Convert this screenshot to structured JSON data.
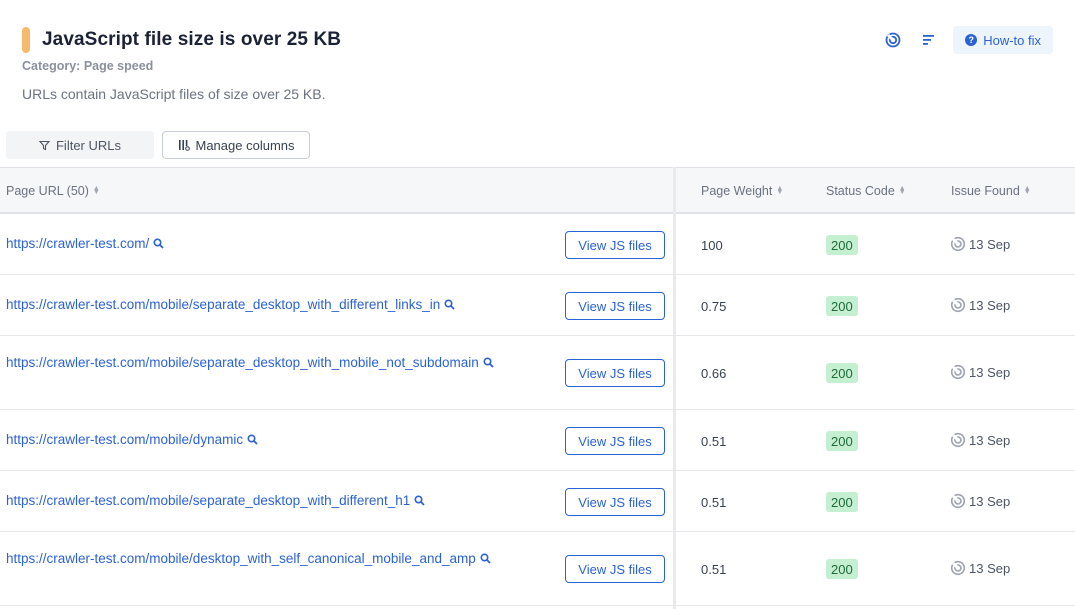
{
  "header": {
    "title": "JavaScript file size is over 25 KB",
    "category": "Category: Page speed",
    "description": "URLs contain JavaScript files of size over 25 KB.",
    "howto_label": "How-to fix",
    "accent_color": "#f7b96b",
    "action_icons": [
      "issue-trend-icon",
      "sort-lines-icon",
      "help-circle-icon"
    ]
  },
  "toolbar": {
    "filter_label": "Filter URLs",
    "manage_label": "Manage columns"
  },
  "table": {
    "columns": [
      {
        "label": "Page URL (50)"
      },
      {
        "label": "Page Weight"
      },
      {
        "label": "Status Code"
      },
      {
        "label": "Issue Found"
      }
    ],
    "view_js_label": "View JS files",
    "rows": [
      {
        "url": "https://crawler-test.com/",
        "weight": "100",
        "status": "200",
        "issue": "13 Sep"
      },
      {
        "url": "https://crawler-test.com/mobile/separate_desktop_with_different_links_in",
        "weight": "0.75",
        "status": "200",
        "issue": "13 Sep"
      },
      {
        "url": "https://crawler-test.com/mobile/separate_desktop_with_mobile_not_subdomain",
        "weight": "0.66",
        "status": "200",
        "issue": "13 Sep"
      },
      {
        "url": "https://crawler-test.com/mobile/dynamic",
        "weight": "0.51",
        "status": "200",
        "issue": "13 Sep"
      },
      {
        "url": "https://crawler-test.com/mobile/separate_desktop_with_different_h1",
        "weight": "0.51",
        "status": "200",
        "issue": "13 Sep"
      },
      {
        "url": "https://crawler-test.com/mobile/desktop_with_self_canonical_mobile_and_amp",
        "weight": "0.51",
        "status": "200",
        "issue": "13 Sep"
      }
    ],
    "link_color": "#2b62d6",
    "status_bg": "#c4efd0"
  }
}
